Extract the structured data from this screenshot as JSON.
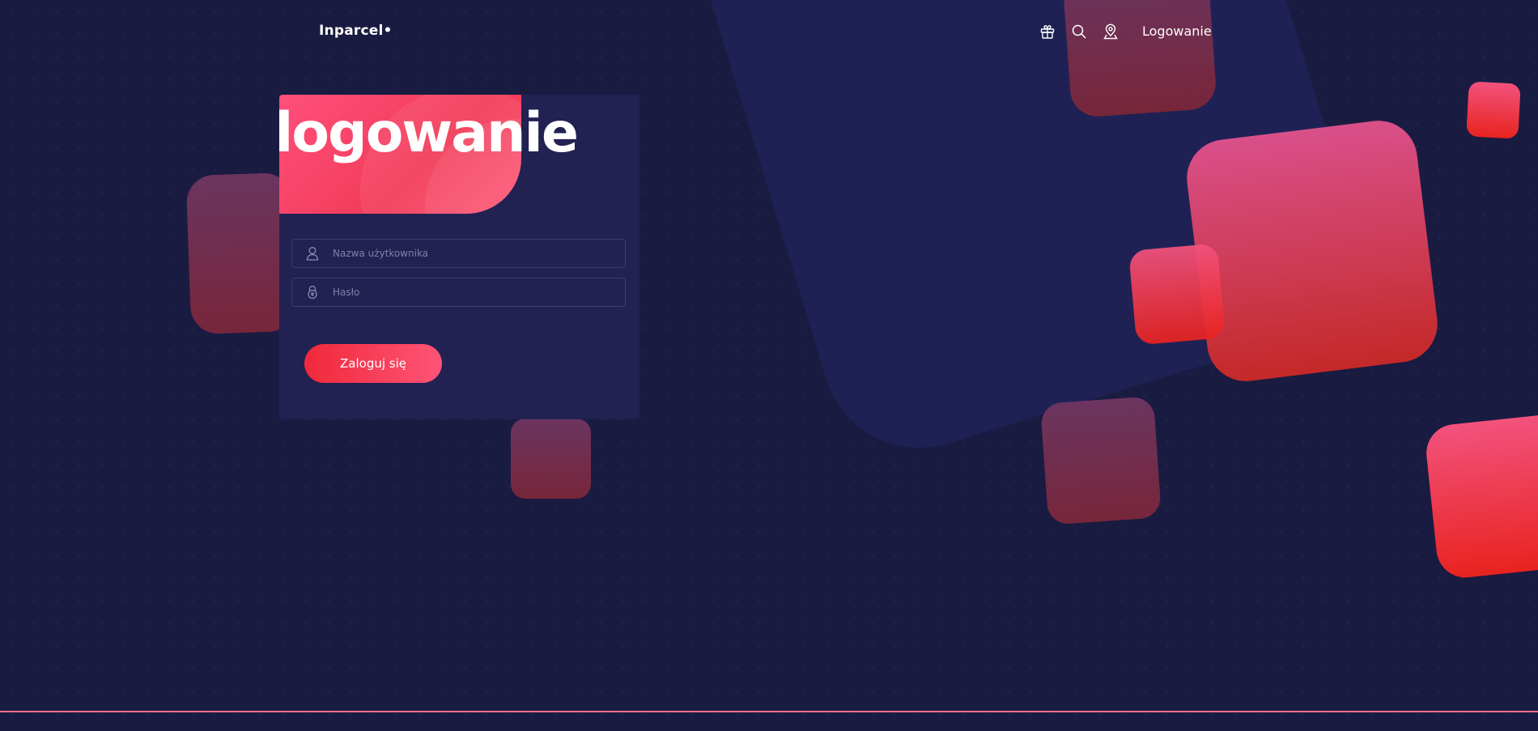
{
  "header": {
    "brand": "Inparcel•",
    "nav_link_label": "Logowanie",
    "icons": [
      "gift-icon",
      "search-icon",
      "location-pin-icon"
    ]
  },
  "login_card": {
    "title": "logowanie",
    "username_placeholder": "Nazwa użytkownika",
    "password_placeholder": "Hasło",
    "submit_label": "Zaloguj się"
  },
  "colors": {
    "background": "#1a1b41",
    "card": "#212152",
    "accent": "#ff4f7b",
    "accent_dark": "#e8231f",
    "footer_line": "#ff6f93"
  }
}
